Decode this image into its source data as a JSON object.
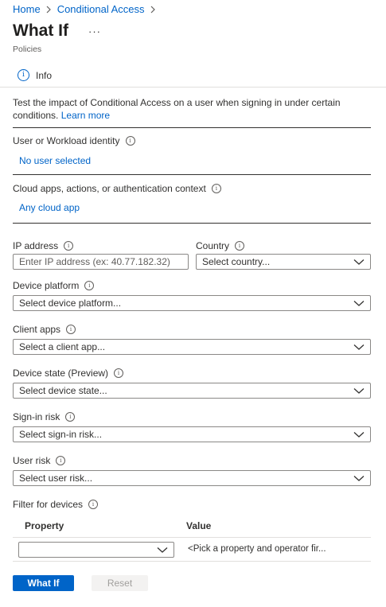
{
  "breadcrumb": {
    "home": "Home",
    "current": "Conditional Access"
  },
  "header": {
    "title": "What If",
    "more": "···",
    "subtitle": "Policies"
  },
  "tabs": {
    "info": "Info"
  },
  "description": {
    "text": "Test the impact of Conditional Access on a user when signing in under certain conditions.",
    "learn_more": "Learn more"
  },
  "identity": {
    "label": "User or Workload identity",
    "value": "No user selected"
  },
  "cloud_apps": {
    "label": "Cloud apps, actions, or authentication context",
    "value": "Any cloud app"
  },
  "ip": {
    "label": "IP address",
    "placeholder": "Enter IP address (ex: 40.77.182.32)"
  },
  "country": {
    "label": "Country",
    "value": "Select country..."
  },
  "device_platform": {
    "label": "Device platform",
    "value": "Select device platform..."
  },
  "client_apps": {
    "label": "Client apps",
    "value": "Select a client app..."
  },
  "device_state": {
    "label": "Device state (Preview)",
    "value": "Select device state..."
  },
  "sign_in_risk": {
    "label": "Sign-in risk",
    "value": "Select sign-in risk..."
  },
  "user_risk": {
    "label": "User risk",
    "value": "Select user risk..."
  },
  "filter": {
    "label": "Filter for devices",
    "col_property": "Property",
    "col_value": "Value",
    "row_property": "",
    "row_value": "<Pick a property and operator fir..."
  },
  "buttons": {
    "what_if": "What If",
    "reset": "Reset"
  },
  "colors": {
    "accent": "#0064c8",
    "text": "#323130",
    "border": "#8a8886"
  }
}
